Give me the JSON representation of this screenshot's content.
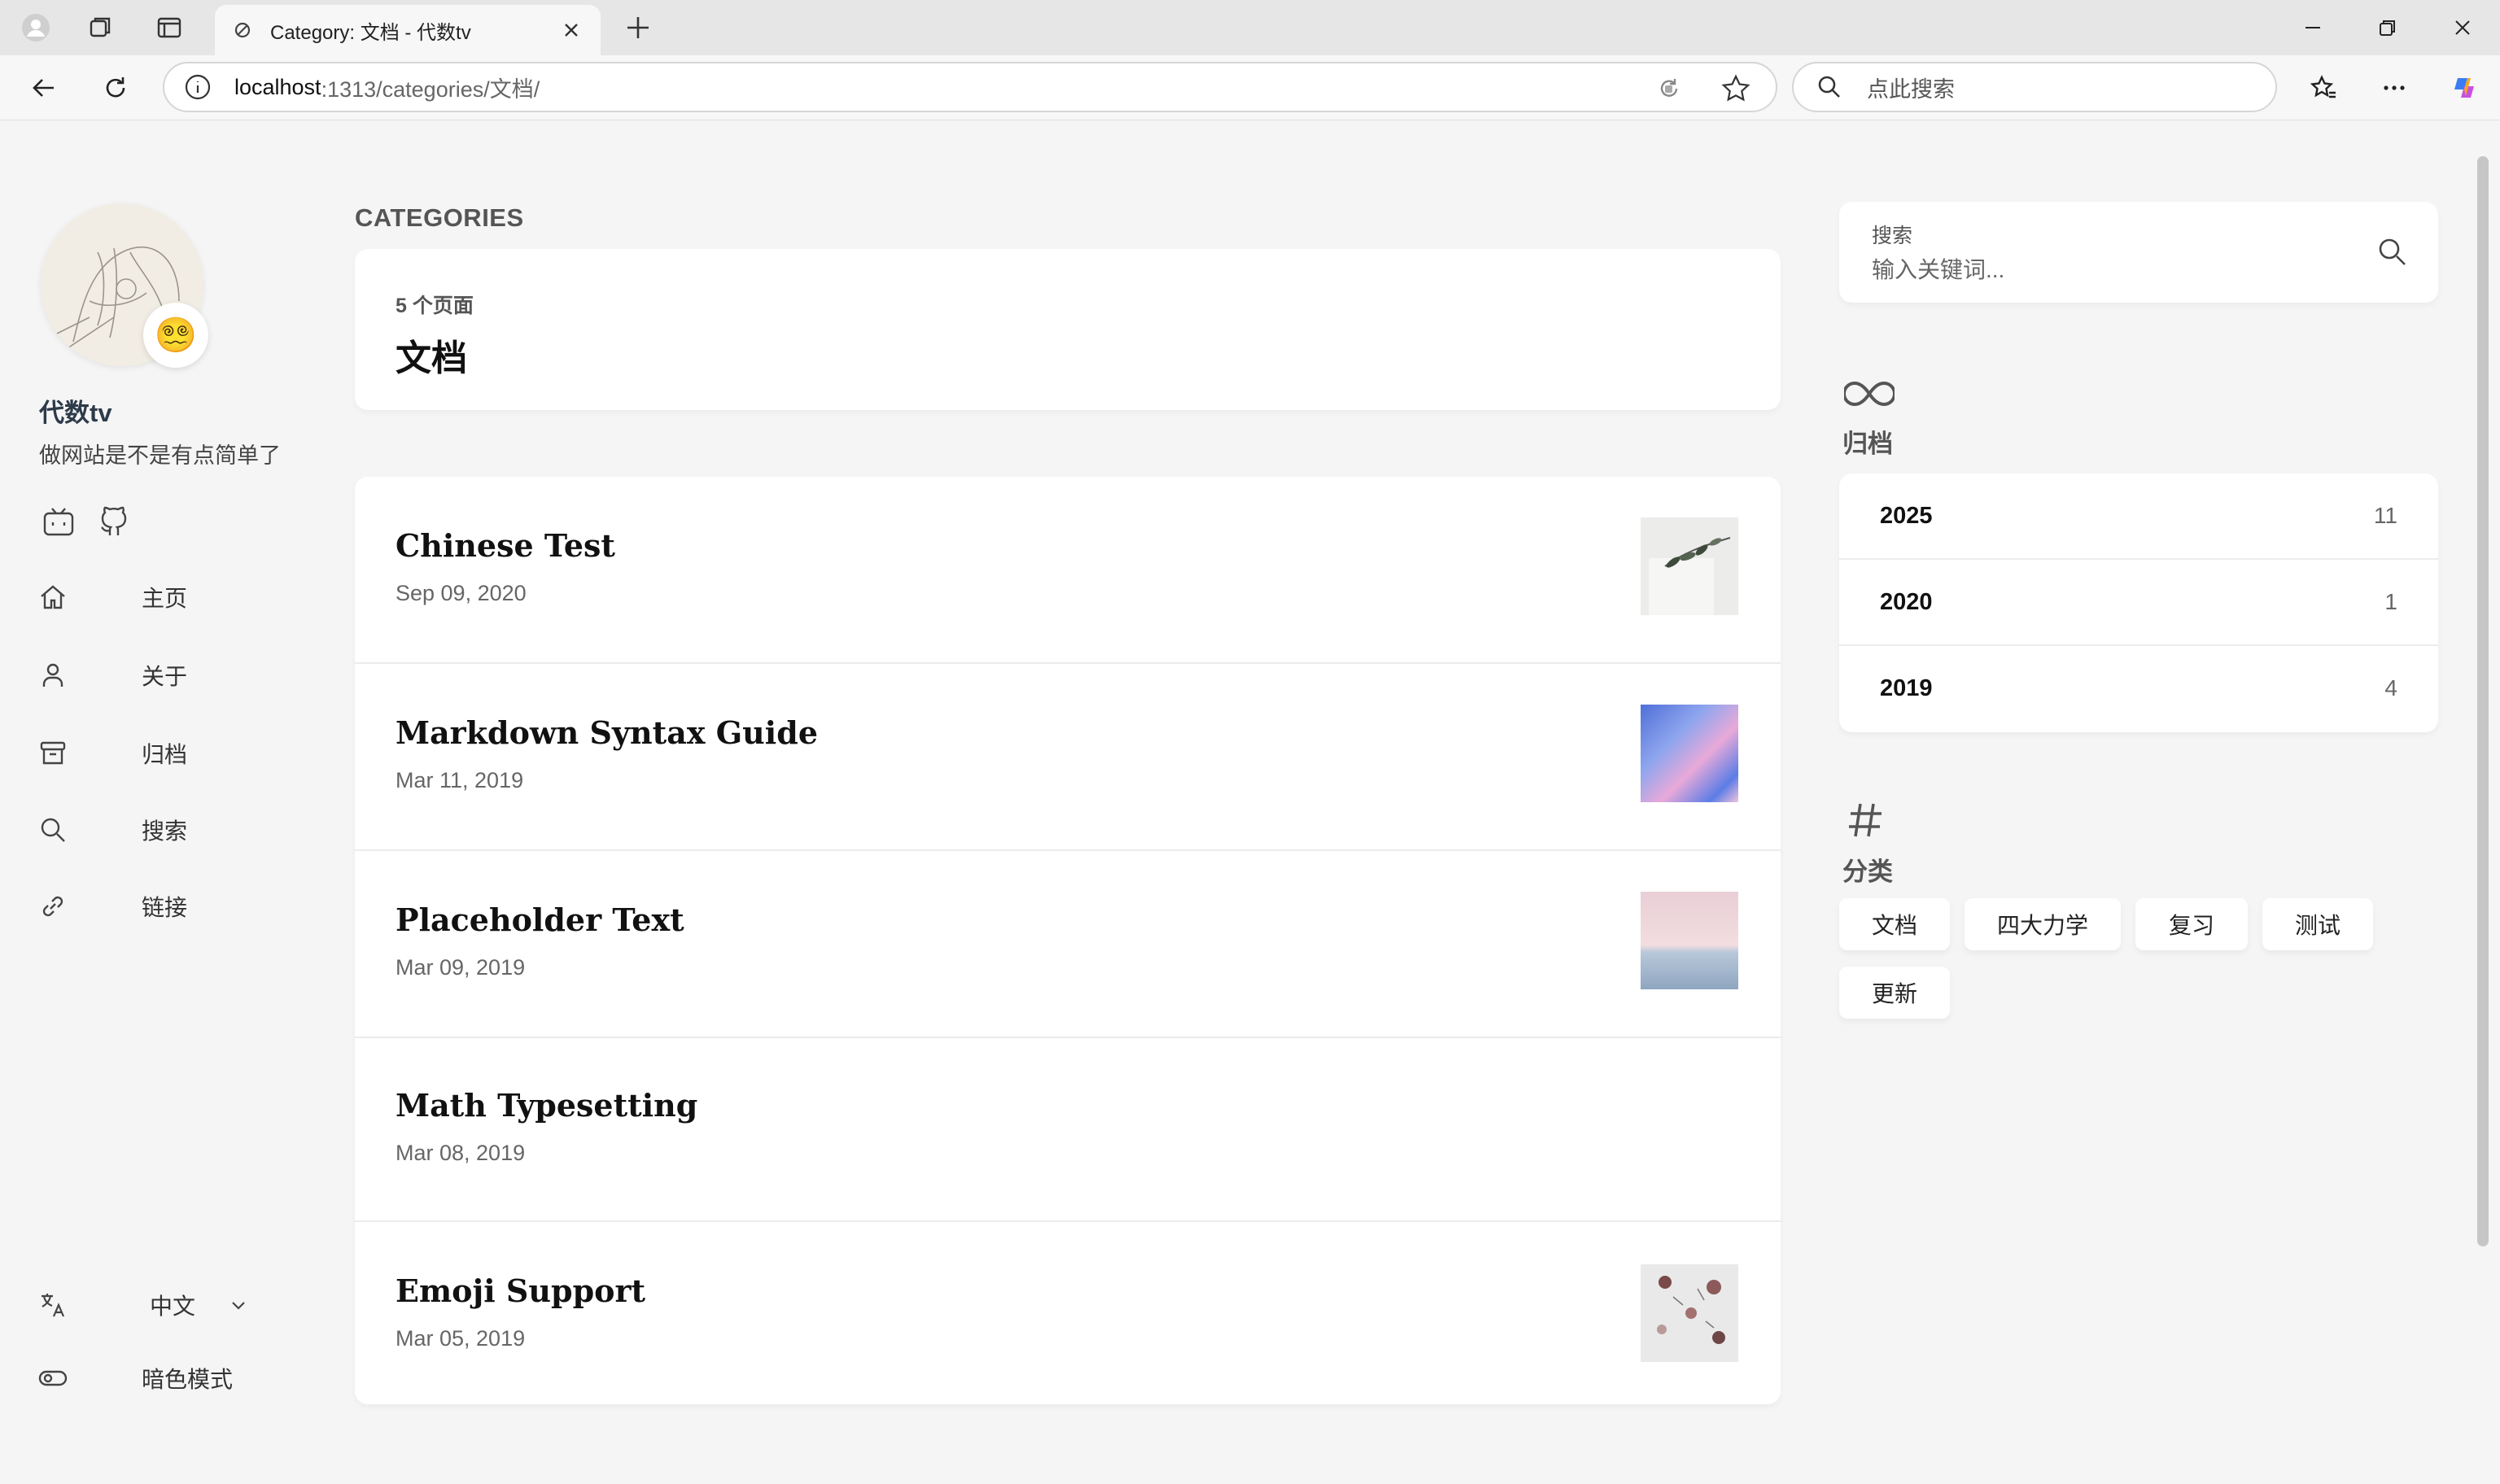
{
  "browser": {
    "tab_title": "Category: 文档 - 代数tv",
    "url_host": "localhost",
    "url_path": ":1313/categories/文档/",
    "search_placeholder": "点此搜索"
  },
  "sidebar": {
    "site_name": "代数tv",
    "site_description": "做网站是不是有点简单了",
    "avatar_emoji": "😵‍💫",
    "social": [
      "bilibili-icon",
      "github-icon"
    ],
    "menu": [
      {
        "label": "主页",
        "icon": "home-icon"
      },
      {
        "label": "关于",
        "icon": "user-icon"
      },
      {
        "label": "归档",
        "icon": "archive-icon"
      },
      {
        "label": "搜索",
        "icon": "search-icon"
      },
      {
        "label": "链接",
        "icon": "link-icon"
      }
    ],
    "language": "中文",
    "dark_mode_label": "暗色模式"
  },
  "main": {
    "section_title": "CATEGORIES",
    "category": {
      "count": "5 个页面",
      "name": "文档"
    },
    "articles": [
      {
        "title": "Chinese Test",
        "date": "Sep 09, 2020",
        "thumb": "plant"
      },
      {
        "title": "Markdown Syntax Guide",
        "date": "Mar 11, 2019",
        "thumb": "abstract"
      },
      {
        "title": "Placeholder Text",
        "date": "Mar 09, 2019",
        "thumb": "sea"
      },
      {
        "title": "Math Typesetting",
        "date": "Mar 08, 2019",
        "thumb": ""
      },
      {
        "title": "Emoji Support",
        "date": "Mar 05, 2019",
        "thumb": "flowers"
      }
    ]
  },
  "right": {
    "search": {
      "label": "搜索",
      "placeholder": "输入关键词..."
    },
    "archive_title": "归档",
    "archives": [
      {
        "year": "2025",
        "count": "11"
      },
      {
        "year": "2020",
        "count": "1"
      },
      {
        "year": "2019",
        "count": "4"
      }
    ],
    "categories_title": "分类",
    "categories": [
      "文档",
      "四大力学",
      "复习",
      "测试",
      "更新"
    ]
  }
}
